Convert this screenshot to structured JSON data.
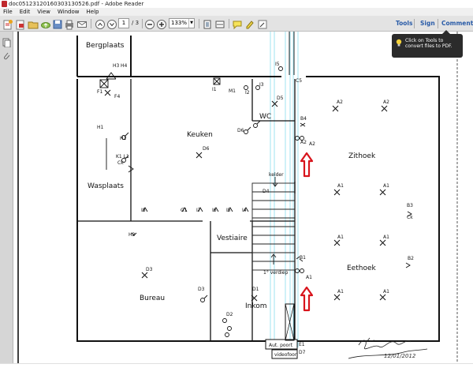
{
  "window": {
    "title": "doc05123120160303130526.pdf - Adobe Reader"
  },
  "menu": [
    "File",
    "Edit",
    "View",
    "Window",
    "Help"
  ],
  "toolbar": {
    "page_current": "1",
    "page_total": "/ 3",
    "zoom": "133%",
    "tools_label": "Tools",
    "sign_label": "Sign",
    "comment_label": "Comment"
  },
  "tooltip": {
    "text": "Click on Tools to convert files to PDF."
  },
  "floorplan": {
    "rooms": {
      "bergplaats": "Bergplaats",
      "keuken": "Keuken",
      "wc": "WC",
      "zithoek": "Zithoek",
      "wasplaats": "Wasplaats",
      "vestiaire": "Vestiaire",
      "eethoek": "Eethoek",
      "bureau": "Bureau",
      "inkom": "Inkom"
    },
    "notes": {
      "kelder": "kelder",
      "verdiep": "1° verdiep",
      "aut_poort": "Aut. poort",
      "videofoon": "videofoon"
    },
    "symbols": {
      "h3": "H3",
      "h4": "H4",
      "f1": "F1",
      "f4": "F4",
      "i1": "I1",
      "m1": "M1",
      "i2": "I2",
      "i3": "I3",
      "i5": "I5",
      "c5": "C5",
      "d5": "D5",
      "d6": "D6",
      "b4": "B4",
      "a2a": "A2",
      "a2b": "A2",
      "a2c": "A2",
      "a2d": "A2",
      "h1": "H1",
      "h1b": "H1",
      "k1": "K1 L1",
      "ck": "Ck",
      "d6b": "D6",
      "d4": "D4",
      "a1a": "A1",
      "a1b": "A1",
      "b3": "B3",
      "ck2": "Ck",
      "i8": "I8",
      "g1": "G1",
      "i7": "I7",
      "i6": "I6",
      "i5b": "I5",
      "i4": "I4",
      "h2": "H2",
      "b1": "B1",
      "a1c": "A1",
      "a1d": "A1",
      "a1e": "A1",
      "b2": "B2",
      "d3": "D3",
      "d3b": "D3",
      "d1": "D1",
      "d2": "D2",
      "a1f": "A1",
      "a1g": "A1",
      "e1": "E1",
      "d7": "D7"
    },
    "signature": "12/01/2012"
  }
}
